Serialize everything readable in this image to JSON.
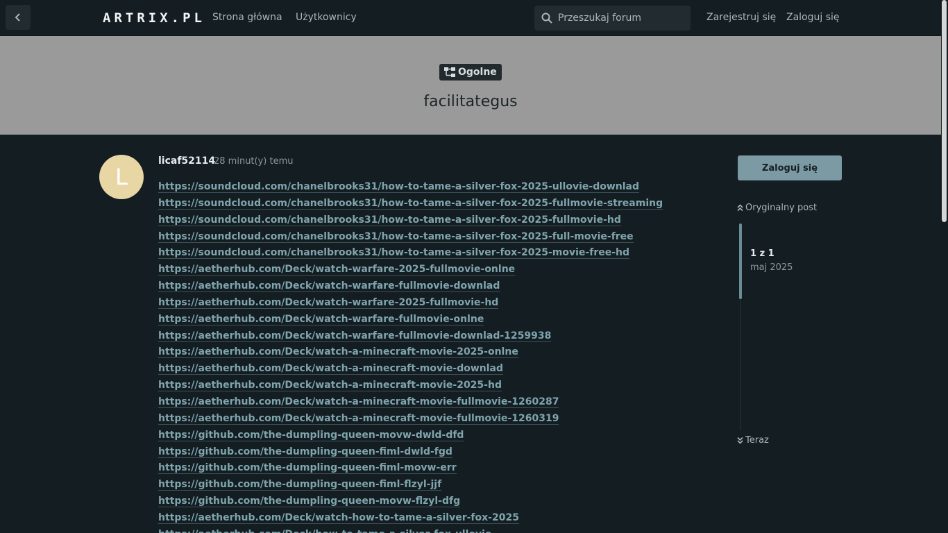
{
  "header": {
    "logo": "ARTRIX.PL",
    "nav": [
      {
        "label": "Strona główna"
      },
      {
        "label": "Użytkownicy"
      }
    ],
    "search_placeholder": "Przeszukaj forum",
    "register_label": "Zarejestruj się",
    "login_label": "Zaloguj się"
  },
  "topic": {
    "category": "Ogolne",
    "title": "facilitategus"
  },
  "post": {
    "avatar_letter": "L",
    "avatar_color": "#e8d6a4",
    "author": "licaf52114",
    "time": "28 minut(y) temu",
    "links": [
      "https://soundcloud.com/chanelbrooks31/how-to-tame-a-silver-fox-2025-ullovie-downlad",
      "https://soundcloud.com/chanelbrooks31/how-to-tame-a-silver-fox-2025-fullmovie-streaming",
      "https://soundcloud.com/chanelbrooks31/how-to-tame-a-silver-fox-2025-fullmovie-hd",
      "https://soundcloud.com/chanelbrooks31/how-to-tame-a-silver-fox-2025-full-movie-free",
      "https://soundcloud.com/chanelbrooks31/how-to-tame-a-silver-fox-2025-movie-free-hd",
      "https://aetherhub.com/Deck/watch-warfare-2025-fullmovie-onlne",
      "https://aetherhub.com/Deck/watch-warfare-fullmovie-downlad",
      "https://aetherhub.com/Deck/watch-warfare-2025-fullmovie-hd",
      "https://aetherhub.com/Deck/watch-warfare-fullmovie-onlne",
      "https://aetherhub.com/Deck/watch-warfare-fullmovie-downlad-1259938",
      "https://aetherhub.com/Deck/watch-a-minecraft-movie-2025-onlne",
      "https://aetherhub.com/Deck/watch-a-minecraft-movie-downlad",
      "https://aetherhub.com/Deck/watch-a-minecraft-movie-2025-hd",
      "https://aetherhub.com/Deck/watch-a-minecraft-movie-fullmovie-1260287",
      "https://aetherhub.com/Deck/watch-a-minecraft-movie-fullmovie-1260319",
      "https://github.com/the-dumpling-queen-movw-dwld-dfd",
      "https://github.com/the-dumpling-queen-fiml-dwld-fgd",
      "https://github.com/the-dumpling-queen-fiml-movw-err",
      "https://github.com/the-dumpling-queen-fiml-flzyl-jjf",
      "https://github.com/the-dumpling-queen-movw-flzyl-dfg",
      "https://aetherhub.com/Deck/watch-how-to-tame-a-silver-fox-2025",
      "https://aetherhub.com/Deck/how-to-tame-a-silver-fox-ullovie"
    ]
  },
  "sidebar": {
    "login_button": "Zaloguj się",
    "original_post": "Oryginalny post",
    "position": "1 z 1",
    "date": "maj 2025",
    "now": "Teraz"
  },
  "colors": {
    "background": "#141e22",
    "hero": "#9a9a9a",
    "link": "#7fa4ad",
    "button": "#7c9aa3"
  }
}
